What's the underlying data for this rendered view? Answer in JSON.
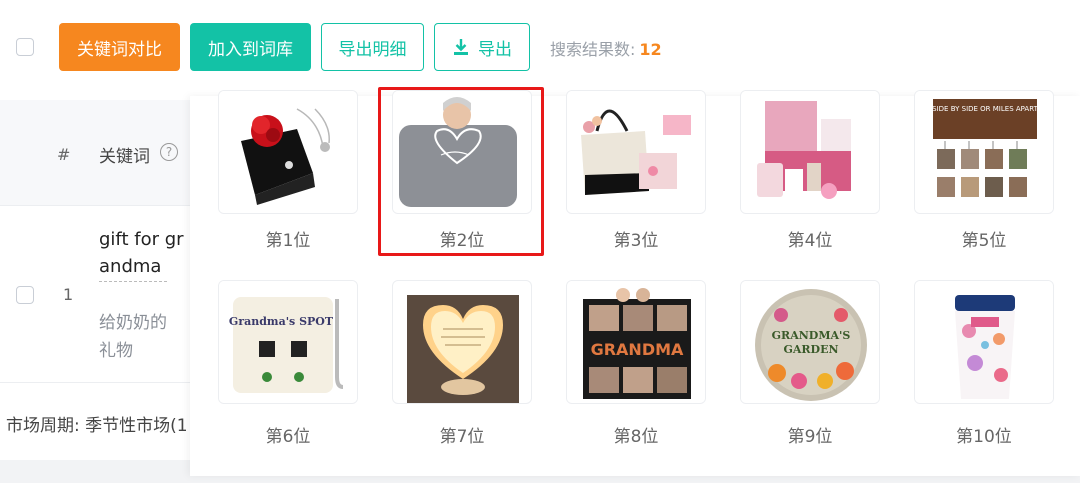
{
  "toolbar": {
    "compare_label": "关键词对比",
    "add_label": "加入到词库",
    "export_detail_label": "导出明细",
    "export_label": "导出",
    "result_label": "搜索结果数:",
    "result_count": "12"
  },
  "table": {
    "col_index": "#",
    "col_keyword": "关键词",
    "help_glyph": "?",
    "row": {
      "index": "1",
      "keyword_en": "gift for grandma",
      "keyword_cn": "给奶奶的礼物"
    },
    "market_cycle": "市场周期: 季节性市场(1"
  },
  "ranks": [
    {
      "label": "第1位",
      "image": "rose box with necklace"
    },
    {
      "label": "第2位",
      "image": "grandma blanket"
    },
    {
      "label": "第3位",
      "image": "tote bag gift set"
    },
    {
      "label": "第4位",
      "image": "pink spa gift box"
    },
    {
      "label": "第5位",
      "image": "grandkids photo sign"
    },
    {
      "label": "第6位",
      "image": "grandma's spot pillow"
    },
    {
      "label": "第7位",
      "image": "heart night light"
    },
    {
      "label": "第8位",
      "image": "best grandma photo blanket"
    },
    {
      "label": "第9位",
      "image": "grandma's garden stone"
    },
    {
      "label": "第10位",
      "image": "floral grandma tumbler"
    }
  ],
  "image_text": {
    "sign_text": "SIDE BY SIDE OR MILES APART",
    "pillow_text": "Grandma's SPOT",
    "blanket_text": "GRANDMA",
    "garden_text_1": "GRANDMA'S",
    "garden_text_2": "GARDEN"
  },
  "colors": {
    "orange": "#f6871f",
    "teal": "#13c2a6",
    "highlight": "#e81818"
  }
}
